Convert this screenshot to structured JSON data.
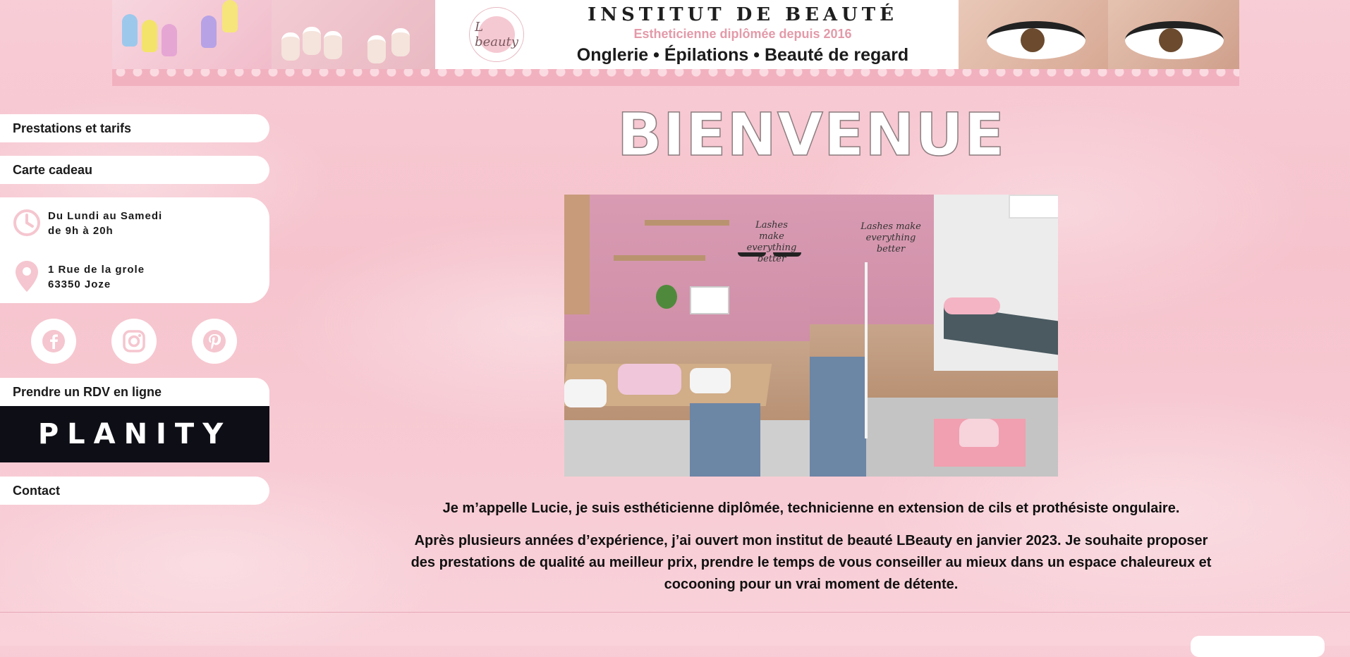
{
  "banner": {
    "title": "INSTITUT DE BEAUTÉ",
    "subtitle": "Estheticienne diplômée depuis 2016",
    "services": "Onglerie • Épilations • Beauté de regard",
    "logo_text": "L beauty"
  },
  "sidebar": {
    "menu_prestations": "Prestations et tarifs",
    "menu_carte": "Carte cadeau",
    "hours_line1": "Du Lundi au Samedi",
    "hours_line2": "de 9h à 20h",
    "address_line1": "1 Rue de la grole",
    "address_line2": "63350 Joze",
    "socials": [
      "facebook-icon",
      "instagram-icon",
      "pinterest-icon"
    ],
    "rdv_label": "Prendre un RDV en ligne",
    "planity": "PLANITY",
    "menu_contact": "Contact"
  },
  "main": {
    "title": "BIENVENUE",
    "wall_text": "Lashes make everything better",
    "intro1": "Je m’appelle Lucie, je suis esthéticienne diplômée, technicienne en extension de cils et prothésiste ongulaire.",
    "intro2_line1": "Après plusieurs années d’expérience, j’ai ouvert mon institut de beauté LBeauty en janvier 2023. Je souhaite proposer",
    "intro2_line2": "des prestations de qualité au meilleur prix, prendre le temps de vous conseiller au mieux dans un espace chaleureux et",
    "intro2_line3": "cocooning pour un vrai moment de détente."
  },
  "colors": {
    "accent_pink": "#f2b1bf",
    "icon_pink": "#f5c6cf",
    "planity_bg": "#0e0e16"
  }
}
